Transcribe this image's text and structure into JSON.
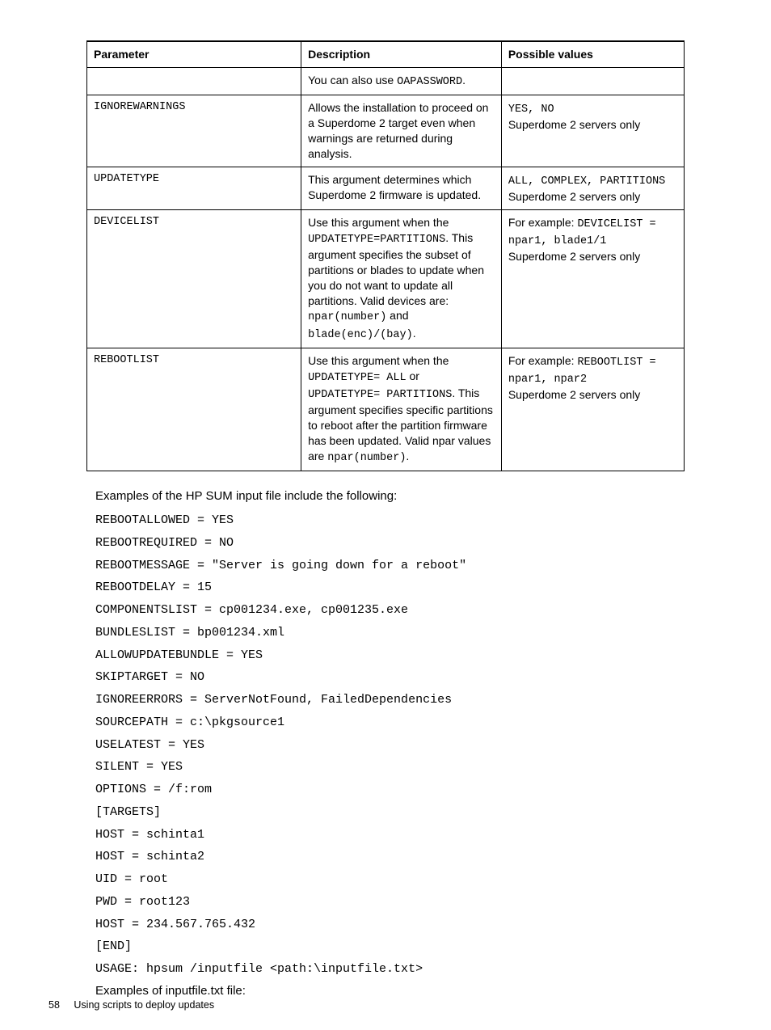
{
  "table": {
    "headers": [
      "Parameter",
      "Description",
      "Possible values"
    ],
    "rows": [
      {
        "param": "",
        "desc_pre": "You can also use ",
        "desc_mono": "OAPASSWORD",
        "desc_post": ".",
        "vals_pre": "",
        "vals_mono": "",
        "vals_post": ""
      },
      {
        "param": "IGNOREWARNINGS",
        "desc_pre": "Allows the installation to proceed on a Superdome 2 target even when warnings are returned during analysis.",
        "desc_mono": "",
        "desc_post": "",
        "vals_pre": "",
        "vals_mono": "YES, NO",
        "vals_post": "Superdome 2 servers only"
      },
      {
        "param": "UPDATETYPE",
        "desc_pre": "This argument determines which Superdome 2 firmware is updated.",
        "desc_mono": "",
        "desc_post": "",
        "vals_pre": "",
        "vals_mono": "ALL, COMPLEX, PARTITIONS",
        "vals_post": "Superdome 2 servers only"
      },
      {
        "param": "DEVICELIST",
        "desc_p1": "Use this argument when the ",
        "desc_m1": "UPDATETYPE=PARTITIONS",
        "desc_p2": ". This argument specifies the subset of partitions or blades to update when you do not want to update all partitions. Valid devices are: ",
        "desc_m2": "npar(number)",
        "desc_p3": " and ",
        "desc_m3": "blade(enc)/(bay)",
        "desc_p4": ".",
        "vals_p1": "For example: ",
        "vals_m1": "DEVICELIST = npar1, blade1/1",
        "vals_p2": "Superdome 2 servers only"
      },
      {
        "param": "REBOOTLIST",
        "desc_p1": "Use this argument when the ",
        "desc_m1": "UPDATETYPE= ALL",
        "desc_p2": " or ",
        "desc_m2": "UPDATETYPE= PARTITIONS",
        "desc_p3": ". This argument specifies specific partitions to reboot after the partition firmware has been updated. Valid npar values are ",
        "desc_m3": "npar(number)",
        "desc_p4": ".",
        "vals_p1": "For example: ",
        "vals_m1": "REBOOTLIST = npar1, npar2",
        "vals_p2": "Superdome 2 servers only"
      }
    ]
  },
  "intro": "Examples of the HP SUM input file include the following:",
  "code": "REBOOTALLOWED = YES\nREBOOTREQUIRED = NO\nREBOOTMESSAGE = \"Server is going down for a reboot\"\nREBOOTDELAY = 15\nCOMPONENTSLIST = cp001234.exe, cp001235.exe\nBUNDLESLIST = bp001234.xml\nALLOWUPDATEBUNDLE = YES\nSKIPTARGET = NO\nIGNOREERRORS = ServerNotFound, FailedDependencies\nSOURCEPATH = c:\\pkgsource1\nUSELATEST = YES\nSILENT = YES\nOPTIONS = /f:rom\n[TARGETS]\nHOST = schinta1\nHOST = schinta2\nUID = root\nPWD = root123\nHOST = 234.567.765.432\n[END]\nUSAGE: hpsum /inputfile <path:\\inputfile.txt>",
  "after": "Examples of inputfile.txt file:",
  "footer": {
    "page": "58",
    "title": "Using scripts to deploy updates"
  }
}
